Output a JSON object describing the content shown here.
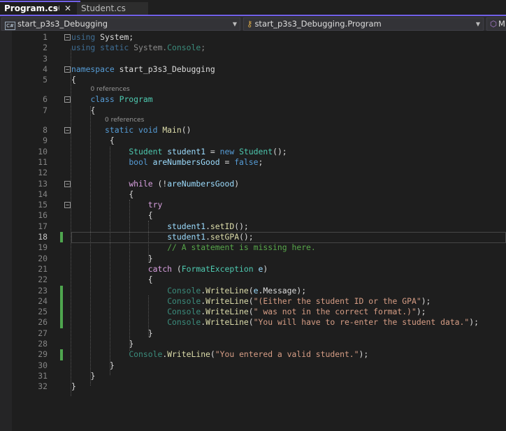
{
  "tabs": [
    {
      "label": "Program.cs",
      "active": true,
      "pin": "⊣",
      "close": "✕"
    },
    {
      "label": "Student.cs",
      "active": false
    }
  ],
  "navbar": {
    "project": "start_p3s3_Debugging",
    "project_icon": "C#",
    "type": "start_p3s3_Debugging.Program",
    "member": "M"
  },
  "colors": {
    "background": "#1e1e1e",
    "accent": "#7160e8",
    "keyword": "#569cd6",
    "type": "#4ec9b0",
    "string": "#d69d85",
    "comment": "#57a64a"
  },
  "lines": [
    {
      "n": "1",
      "indent": 0,
      "fold": true,
      "tokens": [
        [
          "dimkw",
          "using"
        ],
        [
          "pl",
          " System;"
        ]
      ]
    },
    {
      "n": "2",
      "indent": 0,
      "tokens": [
        [
          "dimkw",
          "using static "
        ],
        [
          "dim",
          "System."
        ],
        [
          "dimty",
          "Console"
        ],
        [
          "dim",
          ";"
        ]
      ]
    },
    {
      "n": "3",
      "indent": 0,
      "tokens": []
    },
    {
      "n": "4",
      "indent": 0,
      "fold": true,
      "tokens": [
        [
          "kw",
          "namespace"
        ],
        [
          "pl",
          " start_p3s3_Debugging"
        ]
      ]
    },
    {
      "n": "5",
      "indent": 0,
      "tokens": [
        [
          "pl",
          "{"
        ]
      ]
    },
    {
      "n": "6",
      "indent": 4,
      "fold": true,
      "lens": "0 references",
      "tokens": [
        [
          "kw",
          "class "
        ],
        [
          "ty",
          "Program"
        ]
      ]
    },
    {
      "n": "7",
      "indent": 4,
      "tokens": [
        [
          "pl",
          "{"
        ]
      ]
    },
    {
      "n": "8",
      "indent": 7,
      "fold": true,
      "lens": "0 references",
      "tokens": [
        [
          "kw",
          "static void "
        ],
        [
          "fn",
          "Main"
        ],
        [
          "pl",
          "()"
        ]
      ]
    },
    {
      "n": "9",
      "indent": 8,
      "tokens": [
        [
          "pl",
          "{"
        ]
      ]
    },
    {
      "n": "10",
      "indent": 12,
      "tokens": [
        [
          "ty",
          "Student "
        ],
        [
          "var",
          "student1"
        ],
        [
          "pl",
          " = "
        ],
        [
          "kw",
          "new "
        ],
        [
          "ty",
          "Student"
        ],
        [
          "pl",
          "();"
        ]
      ]
    },
    {
      "n": "11",
      "indent": 12,
      "tokens": [
        [
          "kw",
          "bool "
        ],
        [
          "var",
          "areNumbersGood"
        ],
        [
          "pl",
          " = "
        ],
        [
          "kw",
          "false"
        ],
        [
          "pl",
          ";"
        ]
      ]
    },
    {
      "n": "12",
      "indent": 12,
      "tokens": []
    },
    {
      "n": "13",
      "indent": 12,
      "fold": true,
      "tokens": [
        [
          "ctl",
          "while"
        ],
        [
          "pl",
          " (!"
        ],
        [
          "var",
          "areNumbersGood"
        ],
        [
          "pl",
          ")"
        ]
      ]
    },
    {
      "n": "14",
      "indent": 12,
      "tokens": [
        [
          "pl",
          "{"
        ]
      ]
    },
    {
      "n": "15",
      "indent": 16,
      "fold": true,
      "tokens": [
        [
          "ctl",
          "try"
        ]
      ]
    },
    {
      "n": "16",
      "indent": 16,
      "tokens": [
        [
          "pl",
          "{"
        ]
      ]
    },
    {
      "n": "17",
      "indent": 20,
      "tokens": [
        [
          "var",
          "student1"
        ],
        [
          "pl",
          "."
        ],
        [
          "fn",
          "setID"
        ],
        [
          "pl",
          "();"
        ]
      ]
    },
    {
      "n": "18",
      "indent": 20,
      "changed": true,
      "current": true,
      "tokens": [
        [
          "var",
          "student1"
        ],
        [
          "pl",
          "."
        ],
        [
          "fn",
          "setGPA"
        ],
        [
          "pl",
          "();"
        ]
      ]
    },
    {
      "n": "19",
      "indent": 20,
      "tokens": [
        [
          "cm",
          "// A statement is missing here."
        ]
      ]
    },
    {
      "n": "20",
      "indent": 16,
      "tokens": [
        [
          "pl",
          "}"
        ]
      ]
    },
    {
      "n": "21",
      "indent": 16,
      "tokens": [
        [
          "ctl",
          "catch"
        ],
        [
          "pl",
          " ("
        ],
        [
          "ty",
          "FormatException"
        ],
        [
          "pl",
          " "
        ],
        [
          "var",
          "e"
        ],
        [
          "pl",
          ")"
        ]
      ]
    },
    {
      "n": "22",
      "indent": 16,
      "tokens": [
        [
          "pl",
          "{"
        ]
      ]
    },
    {
      "n": "23",
      "indent": 20,
      "changed": true,
      "tokens": [
        [
          "dimty",
          "Console"
        ],
        [
          "pl",
          "."
        ],
        [
          "fn",
          "WriteLine"
        ],
        [
          "pl",
          "("
        ],
        [
          "var",
          "e"
        ],
        [
          "pl",
          ".Message);"
        ]
      ]
    },
    {
      "n": "24",
      "indent": 20,
      "changed": true,
      "tokens": [
        [
          "dimty",
          "Console"
        ],
        [
          "pl",
          "."
        ],
        [
          "fn",
          "WriteLine"
        ],
        [
          "pl",
          "("
        ],
        [
          "str",
          "\"(Either the student ID or the GPA\""
        ],
        [
          "pl",
          ");"
        ]
      ]
    },
    {
      "n": "25",
      "indent": 20,
      "changed": true,
      "tokens": [
        [
          "dimty",
          "Console"
        ],
        [
          "pl",
          "."
        ],
        [
          "fn",
          "WriteLine"
        ],
        [
          "pl",
          "("
        ],
        [
          "str",
          "\" was not in the correct format.)\""
        ],
        [
          "pl",
          ");"
        ]
      ]
    },
    {
      "n": "26",
      "indent": 20,
      "changed": true,
      "tokens": [
        [
          "dimty",
          "Console"
        ],
        [
          "pl",
          "."
        ],
        [
          "fn",
          "WriteLine"
        ],
        [
          "pl",
          "("
        ],
        [
          "str",
          "\"You will have to re-enter the student data.\""
        ],
        [
          "pl",
          ");"
        ]
      ]
    },
    {
      "n": "27",
      "indent": 16,
      "tokens": [
        [
          "pl",
          "}"
        ]
      ]
    },
    {
      "n": "28",
      "indent": 12,
      "tokens": [
        [
          "pl",
          "}"
        ]
      ]
    },
    {
      "n": "29",
      "indent": 12,
      "changed": true,
      "tokens": [
        [
          "dimty",
          "Console"
        ],
        [
          "pl",
          "."
        ],
        [
          "fn",
          "WriteLine"
        ],
        [
          "pl",
          "("
        ],
        [
          "str",
          "\"You entered a valid student.\""
        ],
        [
          "pl",
          ");"
        ]
      ]
    },
    {
      "n": "30",
      "indent": 8,
      "tokens": [
        [
          "pl",
          "}"
        ]
      ]
    },
    {
      "n": "31",
      "indent": 4,
      "tokens": [
        [
          "pl",
          "}"
        ]
      ]
    },
    {
      "n": "32",
      "indent": 0,
      "tokens": [
        [
          "pl",
          "}"
        ]
      ]
    }
  ]
}
